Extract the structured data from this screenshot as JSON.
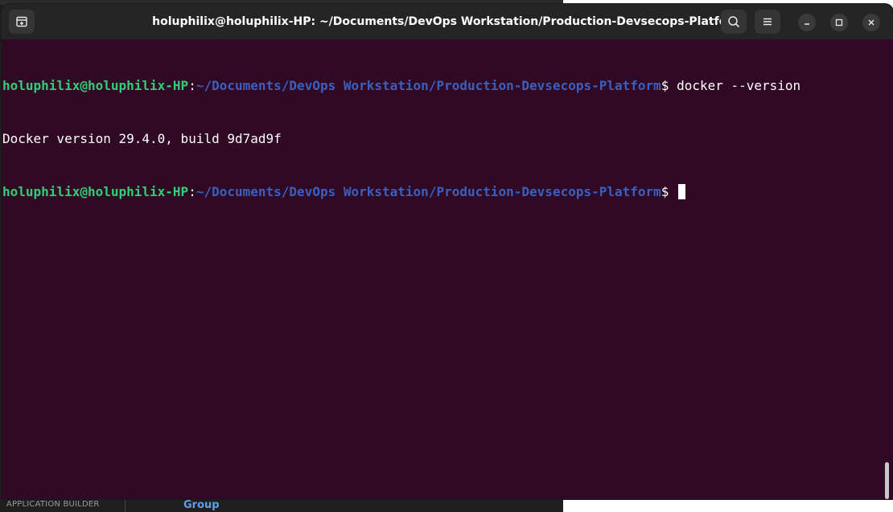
{
  "background": {
    "bottom_left_label": "APPLICATION BUILDER",
    "bottom_group_label": "Group"
  },
  "window": {
    "title": "holuphilix@holuphilix-HP: ~/Documents/DevOps Workstation/Production-Devsecops-Platform",
    "icons": {
      "new_tab": "new-tab-icon",
      "search": "search-icon",
      "menu": "hamburger-menu-icon",
      "minimize": "minimize-icon",
      "maximize": "maximize-icon",
      "close": "close-icon"
    }
  },
  "terminal": {
    "lines": [
      {
        "user_host": "holuphilix@holuphilix-HP",
        "colon": ":",
        "path": "~/Documents/DevOps Workstation/Production-Devsecops-Platform",
        "prompt": "$ ",
        "command": "docker --version"
      },
      {
        "output": "Docker version 29.4.0, build 9d7ad9f"
      },
      {
        "user_host": "holuphilix@holuphilix-HP",
        "colon": ":",
        "path": "~/Documents/DevOps Workstation/Production-Devsecops-Platform",
        "prompt": "$ ",
        "command": ""
      }
    ]
  },
  "colors": {
    "terminal_bg": "#300a24",
    "titlebar_bg": "#252525",
    "user_host": "#33cc77",
    "path": "#3b5fbf",
    "text": "#ffffff"
  }
}
